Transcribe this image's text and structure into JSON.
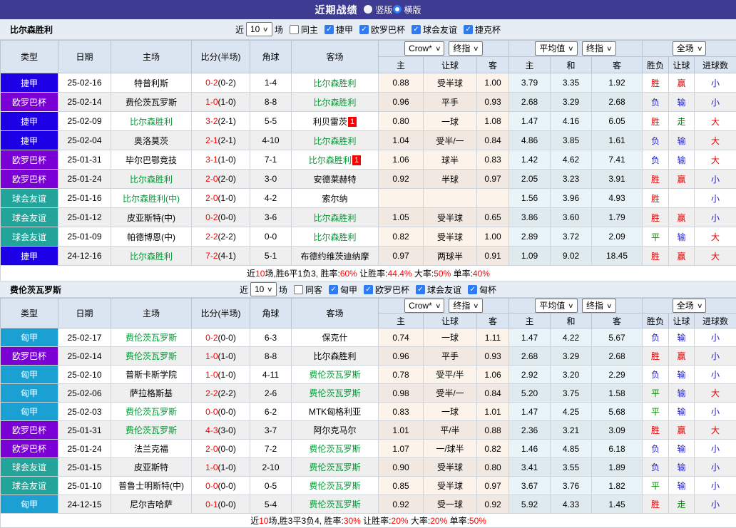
{
  "titlebar": {
    "title": "近期战绩",
    "radios": [
      {
        "label": "竖版",
        "checked": false
      },
      {
        "label": "横版",
        "checked": true
      }
    ]
  },
  "colors": {
    "titlebar_bg": "#3d3b92",
    "accent_blue": "#2e7bf6",
    "team_green": "#009933",
    "score_red": "#ff0000",
    "outcome_red": "#e60000",
    "outcome_blue": "#2121cc",
    "outcome_green": "#008800"
  },
  "league_colors": {
    "捷甲": "#1e00e6",
    "欧罗巴杯": "#7a00d5",
    "球会友谊": "#23a49a",
    "匈甲": "#1aa0d2"
  },
  "header": {
    "main_cols": [
      "类型",
      "日期",
      "主场",
      "比分(半场)",
      "角球",
      "客场"
    ],
    "crow_select": "Crow*",
    "crow_final_select": "终指",
    "crow_cols": [
      "主",
      "让球",
      "客"
    ],
    "avg_select": "平均值",
    "avg_final_select": "终指",
    "avg_cols": [
      "主",
      "和",
      "客"
    ],
    "full_select": "全场",
    "result_cols": [
      "胜负",
      "让球",
      "进球数"
    ]
  },
  "sections": [
    {
      "team": "比尔森胜利",
      "filter": {
        "near_label": "近",
        "count": "10",
        "games_label": "场",
        "same": {
          "label": "同主",
          "checked": false
        },
        "leagues": [
          {
            "label": "捷甲",
            "checked": true
          },
          {
            "label": "欧罗巴杯",
            "checked": true
          },
          {
            "label": "球会友谊",
            "checked": true
          },
          {
            "label": "捷克杯",
            "checked": true
          }
        ]
      },
      "rows": [
        {
          "league": "捷甲",
          "date": "25-02-16",
          "home": "特普利斯",
          "home_self": false,
          "home_badge": "",
          "score": "0-2",
          "half": "(0-2)",
          "corners": "1-4",
          "away": "比尔森胜利",
          "away_self": true,
          "away_badge": "",
          "crow": [
            "0.88",
            "受半球",
            "1.00"
          ],
          "avg": [
            "3.79",
            "3.35",
            "1.92"
          ],
          "outcome": [
            {
              "t": "胜",
              "c": "r"
            },
            {
              "t": "赢",
              "c": "r"
            },
            {
              "t": "小",
              "c": "b"
            }
          ]
        },
        {
          "league": "欧罗巴杯",
          "date": "25-02-14",
          "home": "费伦茨瓦罗斯",
          "home_self": false,
          "home_badge": "",
          "score": "1-0",
          "half": "(1-0)",
          "corners": "8-8",
          "away": "比尔森胜利",
          "away_self": true,
          "away_badge": "",
          "crow": [
            "0.96",
            "平手",
            "0.93"
          ],
          "avg": [
            "2.68",
            "3.29",
            "2.68"
          ],
          "outcome": [
            {
              "t": "负",
              "c": "b"
            },
            {
              "t": "输",
              "c": "b"
            },
            {
              "t": "小",
              "c": "b"
            }
          ]
        },
        {
          "league": "捷甲",
          "date": "25-02-09",
          "home": "比尔森胜利",
          "home_self": true,
          "home_badge": "",
          "score": "3-2",
          "half": "(2-1)",
          "corners": "5-5",
          "away": "利贝雷茨",
          "away_self": false,
          "away_badge": "1",
          "crow": [
            "0.80",
            "一球",
            "1.08"
          ],
          "avg": [
            "1.47",
            "4.16",
            "6.05"
          ],
          "outcome": [
            {
              "t": "胜",
              "c": "r"
            },
            {
              "t": "走",
              "c": "g"
            },
            {
              "t": "大",
              "c": "r"
            }
          ]
        },
        {
          "league": "捷甲",
          "date": "25-02-04",
          "home": "奥洛莫茨",
          "home_self": false,
          "home_badge": "",
          "score": "2-1",
          "half": "(2-1)",
          "corners": "4-10",
          "away": "比尔森胜利",
          "away_self": true,
          "away_badge": "",
          "crow": [
            "1.04",
            "受半/一",
            "0.84"
          ],
          "avg": [
            "4.86",
            "3.85",
            "1.61"
          ],
          "outcome": [
            {
              "t": "负",
              "c": "b"
            },
            {
              "t": "输",
              "c": "b"
            },
            {
              "t": "大",
              "c": "r"
            }
          ]
        },
        {
          "league": "欧罗巴杯",
          "date": "25-01-31",
          "home": "毕尔巴鄂竞技",
          "home_self": false,
          "home_badge": "",
          "score": "3-1",
          "half": "(1-0)",
          "corners": "7-1",
          "away": "比尔森胜利",
          "away_self": true,
          "away_badge": "1",
          "crow": [
            "1.06",
            "球半",
            "0.83"
          ],
          "avg": [
            "1.42",
            "4.62",
            "7.41"
          ],
          "outcome": [
            {
              "t": "负",
              "c": "b"
            },
            {
              "t": "输",
              "c": "b"
            },
            {
              "t": "大",
              "c": "r"
            }
          ]
        },
        {
          "league": "欧罗巴杯",
          "date": "25-01-24",
          "home": "比尔森胜利",
          "home_self": true,
          "home_badge": "",
          "score": "2-0",
          "half": "(2-0)",
          "corners": "3-0",
          "away": "安德莱赫特",
          "away_self": false,
          "away_badge": "",
          "crow": [
            "0.92",
            "半球",
            "0.97"
          ],
          "avg": [
            "2.05",
            "3.23",
            "3.91"
          ],
          "outcome": [
            {
              "t": "胜",
              "c": "r"
            },
            {
              "t": "赢",
              "c": "r"
            },
            {
              "t": "小",
              "c": "b"
            }
          ]
        },
        {
          "league": "球会友谊",
          "date": "25-01-16",
          "home": "比尔森胜利(中)",
          "home_self": true,
          "home_badge": "",
          "score": "2-0",
          "half": "(1-0)",
          "corners": "4-2",
          "away": "索尔纳",
          "away_self": false,
          "away_badge": "",
          "crow": [
            "",
            "",
            ""
          ],
          "avg": [
            "1.56",
            "3.96",
            "4.93"
          ],
          "outcome": [
            {
              "t": "胜",
              "c": "r"
            },
            {
              "t": "",
              "c": ""
            },
            {
              "t": "小",
              "c": "b"
            }
          ]
        },
        {
          "league": "球会友谊",
          "date": "25-01-12",
          "home": "皮亚斯特(中)",
          "home_self": false,
          "home_badge": "",
          "score": "0-2",
          "half": "(0-0)",
          "corners": "3-6",
          "away": "比尔森胜利",
          "away_self": true,
          "away_badge": "",
          "crow": [
            "1.05",
            "受半球",
            "0.65"
          ],
          "avg": [
            "3.86",
            "3.60",
            "1.79"
          ],
          "outcome": [
            {
              "t": "胜",
              "c": "r"
            },
            {
              "t": "赢",
              "c": "r"
            },
            {
              "t": "小",
              "c": "b"
            }
          ]
        },
        {
          "league": "球会友谊",
          "date": "25-01-09",
          "home": "帕德博恩(中)",
          "home_self": false,
          "home_badge": "",
          "score": "2-2",
          "half": "(2-2)",
          "corners": "0-0",
          "away": "比尔森胜利",
          "away_self": true,
          "away_badge": "",
          "crow": [
            "0.82",
            "受半球",
            "1.00"
          ],
          "avg": [
            "2.89",
            "3.72",
            "2.09"
          ],
          "outcome": [
            {
              "t": "平",
              "c": "g"
            },
            {
              "t": "输",
              "c": "b"
            },
            {
              "t": "大",
              "c": "r"
            }
          ]
        },
        {
          "league": "捷甲",
          "date": "24-12-16",
          "home": "比尔森胜利",
          "home_self": true,
          "home_badge": "",
          "score": "7-2",
          "half": "(4-1)",
          "corners": "5-1",
          "away": "布德约维茨迪纳摩",
          "away_self": false,
          "away_badge": "",
          "crow": [
            "0.97",
            "两球半",
            "0.91"
          ],
          "avg": [
            "1.09",
            "9.02",
            "18.45"
          ],
          "outcome": [
            {
              "t": "胜",
              "c": "r"
            },
            {
              "t": "赢",
              "c": "r"
            },
            {
              "t": "大",
              "c": "r"
            }
          ]
        }
      ],
      "summary": [
        {
          "text": "近"
        },
        {
          "text": "10",
          "red": true
        },
        {
          "text": "场,胜6平1负3, 胜率:"
        },
        {
          "text": "60%",
          "red": true
        },
        {
          "text": " 让胜率:"
        },
        {
          "text": "44.4%",
          "red": true
        },
        {
          "text": " 大率:"
        },
        {
          "text": "50%",
          "red": true
        },
        {
          "text": " 单率:"
        },
        {
          "text": "40%",
          "red": true
        }
      ]
    },
    {
      "team": "费伦茨瓦罗斯",
      "filter": {
        "near_label": "近",
        "count": "10",
        "games_label": "场",
        "same": {
          "label": "同客",
          "checked": false
        },
        "leagues": [
          {
            "label": "匈甲",
            "checked": true
          },
          {
            "label": "欧罗巴杯",
            "checked": true
          },
          {
            "label": "球会友谊",
            "checked": true
          },
          {
            "label": "匈杯",
            "checked": true
          }
        ]
      },
      "rows": [
        {
          "league": "匈甲",
          "date": "25-02-17",
          "home": "费伦茨瓦罗斯",
          "home_self": true,
          "home_badge": "",
          "score": "0-2",
          "half": "(0-0)",
          "corners": "6-3",
          "away": "保克什",
          "away_self": false,
          "away_badge": "",
          "crow": [
            "0.74",
            "一球",
            "1.11"
          ],
          "avg": [
            "1.47",
            "4.22",
            "5.67"
          ],
          "outcome": [
            {
              "t": "负",
              "c": "b"
            },
            {
              "t": "输",
              "c": "b"
            },
            {
              "t": "小",
              "c": "b"
            }
          ]
        },
        {
          "league": "欧罗巴杯",
          "date": "25-02-14",
          "home": "费伦茨瓦罗斯",
          "home_self": true,
          "home_badge": "",
          "score": "1-0",
          "half": "(1-0)",
          "corners": "8-8",
          "away": "比尔森胜利",
          "away_self": false,
          "away_badge": "",
          "crow": [
            "0.96",
            "平手",
            "0.93"
          ],
          "avg": [
            "2.68",
            "3.29",
            "2.68"
          ],
          "outcome": [
            {
              "t": "胜",
              "c": "r"
            },
            {
              "t": "赢",
              "c": "r"
            },
            {
              "t": "小",
              "c": "b"
            }
          ]
        },
        {
          "league": "匈甲",
          "date": "25-02-10",
          "home": "普斯卡斯学院",
          "home_self": false,
          "home_badge": "",
          "score": "1-0",
          "half": "(1-0)",
          "corners": "4-11",
          "away": "费伦茨瓦罗斯",
          "away_self": true,
          "away_badge": "",
          "crow": [
            "0.78",
            "受平/半",
            "1.06"
          ],
          "avg": [
            "2.92",
            "3.20",
            "2.29"
          ],
          "outcome": [
            {
              "t": "负",
              "c": "b"
            },
            {
              "t": "输",
              "c": "b"
            },
            {
              "t": "小",
              "c": "b"
            }
          ]
        },
        {
          "league": "匈甲",
          "date": "25-02-06",
          "home": "萨拉格斯基",
          "home_self": false,
          "home_badge": "",
          "score": "2-2",
          "half": "(2-2)",
          "corners": "2-6",
          "away": "费伦茨瓦罗斯",
          "away_self": true,
          "away_badge": "",
          "crow": [
            "0.98",
            "受半/一",
            "0.84"
          ],
          "avg": [
            "5.20",
            "3.75",
            "1.58"
          ],
          "outcome": [
            {
              "t": "平",
              "c": "g"
            },
            {
              "t": "输",
              "c": "b"
            },
            {
              "t": "大",
              "c": "r"
            }
          ]
        },
        {
          "league": "匈甲",
          "date": "25-02-03",
          "home": "费伦茨瓦罗斯",
          "home_self": true,
          "home_badge": "",
          "score": "0-0",
          "half": "(0-0)",
          "corners": "6-2",
          "away": "MTK匈格利亚",
          "away_self": false,
          "away_badge": "",
          "crow": [
            "0.83",
            "一球",
            "1.01"
          ],
          "avg": [
            "1.47",
            "4.25",
            "5.68"
          ],
          "outcome": [
            {
              "t": "平",
              "c": "g"
            },
            {
              "t": "输",
              "c": "b"
            },
            {
              "t": "小",
              "c": "b"
            }
          ]
        },
        {
          "league": "欧罗巴杯",
          "date": "25-01-31",
          "home": "费伦茨瓦罗斯",
          "home_self": true,
          "home_badge": "",
          "score": "4-3",
          "half": "(3-0)",
          "corners": "3-7",
          "away": "阿尔克马尔",
          "away_self": false,
          "away_badge": "",
          "crow": [
            "1.01",
            "平/半",
            "0.88"
          ],
          "avg": [
            "2.36",
            "3.21",
            "3.09"
          ],
          "outcome": [
            {
              "t": "胜",
              "c": "r"
            },
            {
              "t": "赢",
              "c": "r"
            },
            {
              "t": "大",
              "c": "r"
            }
          ]
        },
        {
          "league": "欧罗巴杯",
          "date": "25-01-24",
          "home": "法兰克福",
          "home_self": false,
          "home_badge": "",
          "score": "2-0",
          "half": "(0-0)",
          "corners": "7-2",
          "away": "费伦茨瓦罗斯",
          "away_self": true,
          "away_badge": "",
          "crow": [
            "1.07",
            "一/球半",
            "0.82"
          ],
          "avg": [
            "1.46",
            "4.85",
            "6.18"
          ],
          "outcome": [
            {
              "t": "负",
              "c": "b"
            },
            {
              "t": "输",
              "c": "b"
            },
            {
              "t": "小",
              "c": "b"
            }
          ]
        },
        {
          "league": "球会友谊",
          "date": "25-01-15",
          "home": "皮亚斯特",
          "home_self": false,
          "home_badge": "",
          "score": "1-0",
          "half": "(1-0)",
          "corners": "2-10",
          "away": "费伦茨瓦罗斯",
          "away_self": true,
          "away_badge": "",
          "crow": [
            "0.90",
            "受半球",
            "0.80"
          ],
          "avg": [
            "3.41",
            "3.55",
            "1.89"
          ],
          "outcome": [
            {
              "t": "负",
              "c": "b"
            },
            {
              "t": "输",
              "c": "b"
            },
            {
              "t": "小",
              "c": "b"
            }
          ]
        },
        {
          "league": "球会友谊",
          "date": "25-01-10",
          "home": "普鲁士明斯特(中)",
          "home_self": false,
          "home_badge": "",
          "score": "0-0",
          "half": "(0-0)",
          "corners": "0-5",
          "away": "费伦茨瓦罗斯",
          "away_self": true,
          "away_badge": "",
          "crow": [
            "0.85",
            "受半球",
            "0.97"
          ],
          "avg": [
            "3.67",
            "3.76",
            "1.82"
          ],
          "outcome": [
            {
              "t": "平",
              "c": "g"
            },
            {
              "t": "输",
              "c": "b"
            },
            {
              "t": "小",
              "c": "b"
            }
          ]
        },
        {
          "league": "匈甲",
          "date": "24-12-15",
          "home": "尼尔吉哈萨",
          "home_self": false,
          "home_badge": "",
          "score": "0-1",
          "half": "(0-0)",
          "corners": "5-4",
          "away": "费伦茨瓦罗斯",
          "away_self": true,
          "away_badge": "",
          "crow": [
            "0.92",
            "受一球",
            "0.92"
          ],
          "avg": [
            "5.92",
            "4.33",
            "1.45"
          ],
          "outcome": [
            {
              "t": "胜",
              "c": "r"
            },
            {
              "t": "走",
              "c": "g"
            },
            {
              "t": "小",
              "c": "b"
            }
          ]
        }
      ],
      "summary": [
        {
          "text": "近"
        },
        {
          "text": "10",
          "red": true
        },
        {
          "text": "场,胜3平3负4, 胜率:"
        },
        {
          "text": "30%",
          "red": true
        },
        {
          "text": " 让胜率:"
        },
        {
          "text": "20%",
          "red": true
        },
        {
          "text": " 大率:"
        },
        {
          "text": "20%",
          "red": true
        },
        {
          "text": " 单率:"
        },
        {
          "text": "50%",
          "red": true
        }
      ]
    }
  ]
}
